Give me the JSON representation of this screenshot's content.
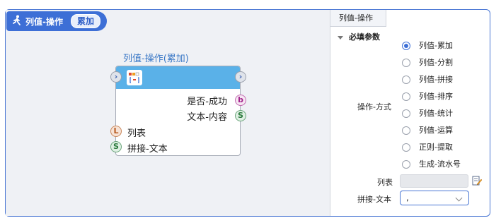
{
  "header": {
    "title": "列值-操作",
    "mode_badge": "累加",
    "icon": "walk-icon"
  },
  "node": {
    "title": "列值-操作(累加)",
    "outputs": [
      {
        "label": "是否-成功",
        "port": "b"
      },
      {
        "label": "文本-内容",
        "port": "S"
      }
    ],
    "inputs": [
      {
        "label": "列表",
        "port": "L"
      },
      {
        "label": "拼接-文本",
        "port": "S"
      }
    ]
  },
  "panel": {
    "tab_label": "列值-操作",
    "section_label": "必填参数",
    "operation_label": "操作-方式",
    "options": [
      {
        "label": "列值-累加",
        "selected": true
      },
      {
        "label": "列值-分割",
        "selected": false
      },
      {
        "label": "列值-拼接",
        "selected": false
      },
      {
        "label": "列值-排序",
        "selected": false
      },
      {
        "label": "列值-统计",
        "selected": false
      },
      {
        "label": "列值-运算",
        "selected": false
      },
      {
        "label": "正则-提取",
        "selected": false
      },
      {
        "label": "生成-流水号",
        "selected": false
      }
    ],
    "list_label": "列表",
    "list_value": "",
    "join_label": "拼接-文本",
    "join_value": ","
  },
  "colors": {
    "accent": "#3d6fd6",
    "node_header": "#5ab1e8",
    "canvas_bg": "#eff1f5"
  }
}
